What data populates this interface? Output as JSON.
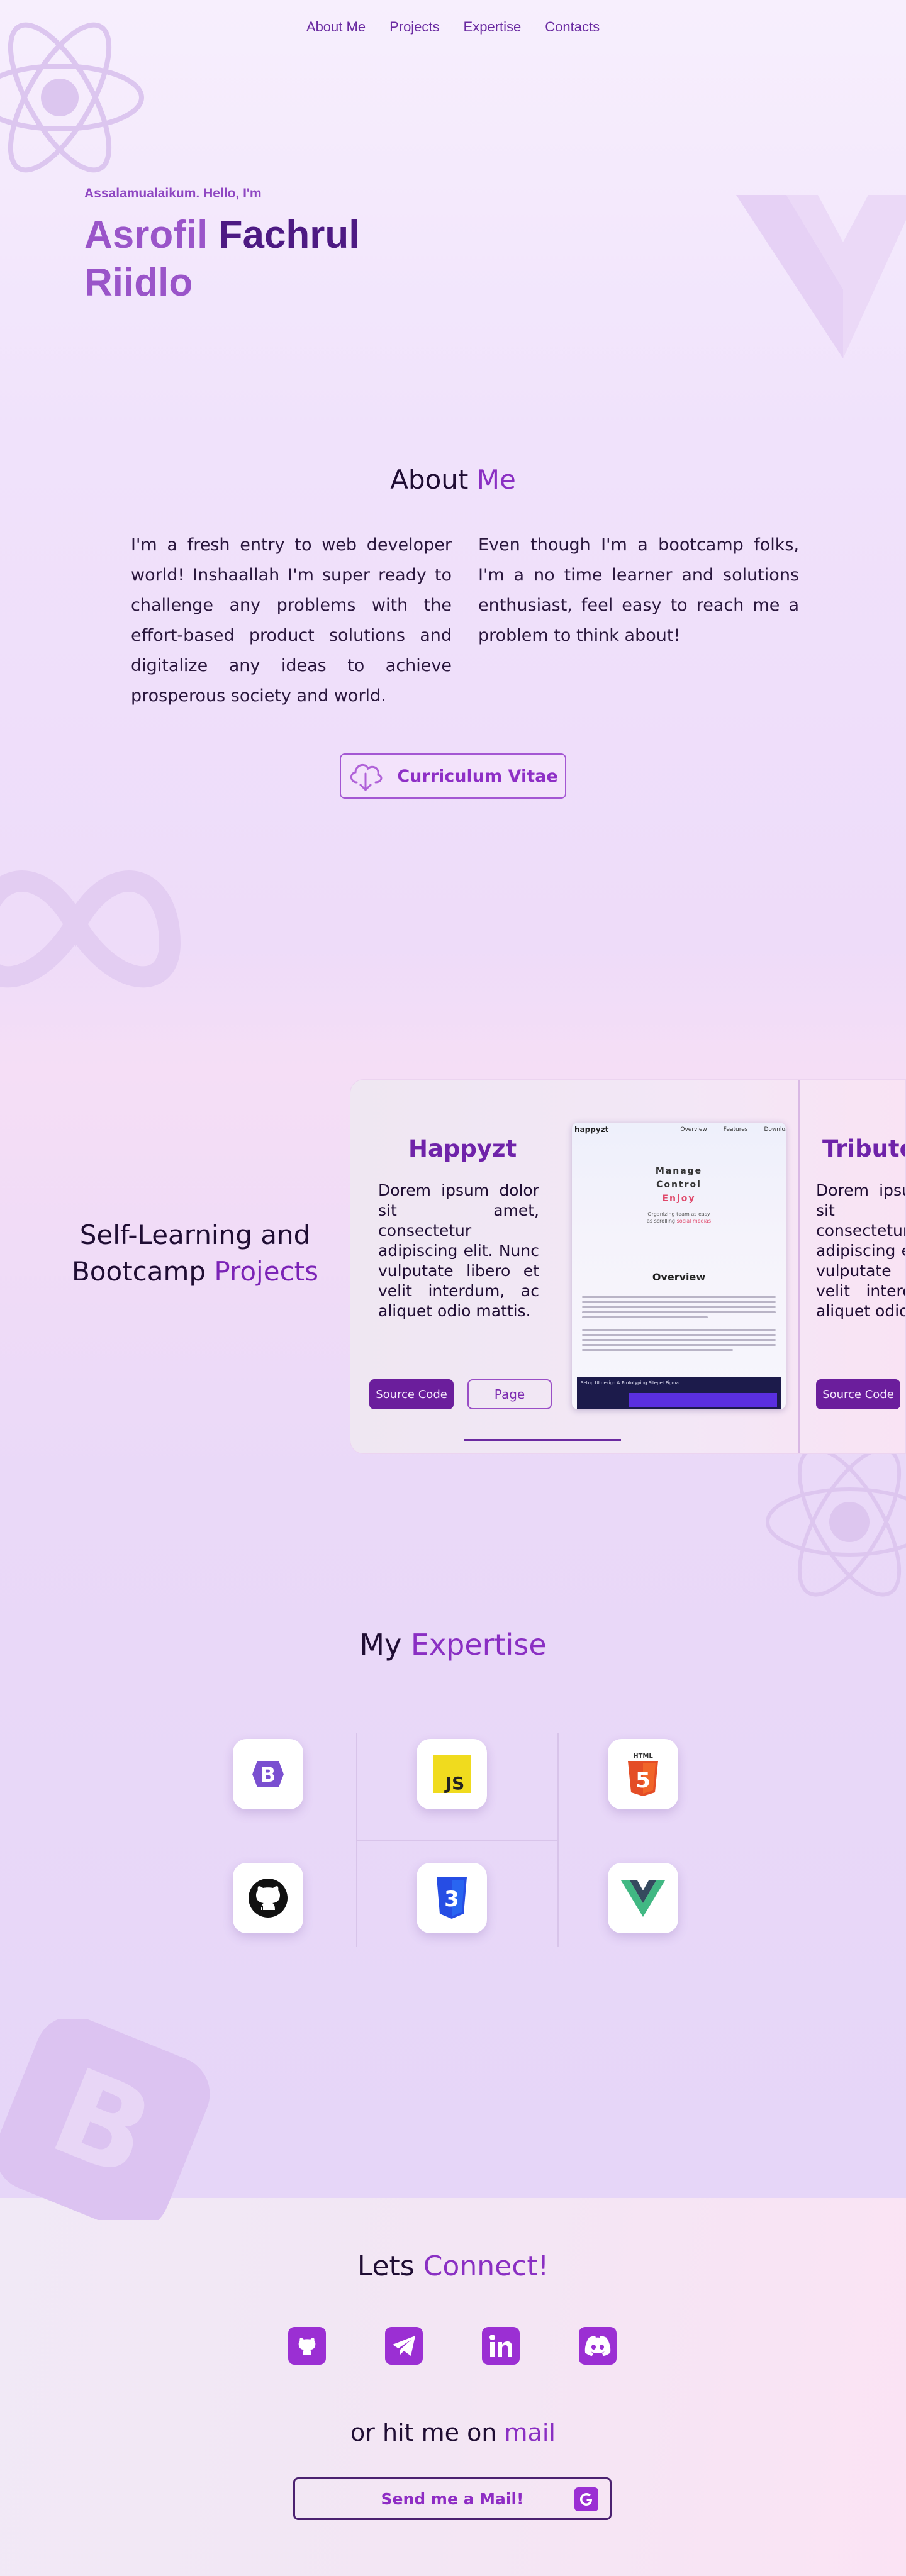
{
  "nav": {
    "items": [
      "About Me",
      "Projects",
      "Expertise",
      "Contacts"
    ]
  },
  "hero": {
    "greeting": "Assalamualaikum. Hello, I'm",
    "name_first": "Asrofil",
    "name_middle": "Fachrul",
    "name_last": "Riidlo"
  },
  "about": {
    "title_plain": "About",
    "title_accent": "Me",
    "paragraph_left": "I'm a fresh entry to web developer world! Inshaallah I'm super ready to challenge any problems with the effort-based product solutions and digitalize any ideas to achieve prosperous society and world.",
    "paragraph_right": "Even though I'm a bootcamp folks,  I'm a no time learner and solutions enthusiast, feel easy to reach me a problem to think about!",
    "cv_button": "Curriculum Vitae",
    "cv_icon": "cloud-download-icon"
  },
  "projects": {
    "heading_plain": "Self-Learning and Bootcamp",
    "heading_accent": "Projects",
    "cards": [
      {
        "title": "Happyzt",
        "description": "Dorem ipsum dolor sit amet, consectetur adipiscing elit. Nunc vulputate libero et velit interdum, ac aliquet odio mattis.",
        "source_button": "Source Code",
        "page_button": "Page",
        "preview": {
          "logo": "happyzt",
          "nav": [
            "Overview",
            "Features",
            "Download"
          ],
          "headline_1": "Manage",
          "headline_2": "Control",
          "headline_3": "Enjoy",
          "sub_1": "Organizing team as easy",
          "sub_2_plain": "as scrolling",
          "sub_2_red": "social medias",
          "section": "Overview",
          "video_title": "Setup UI design & Prototyping Sitepet Figma"
        }
      },
      {
        "title": "Tribute",
        "description": "Dorem ipsum dolor sit amet, consectetur adipiscing elit. Nunc vulputate libero et velit interdum, ac aliquet odio mattis.",
        "source_button": "Source Code"
      }
    ]
  },
  "expertise": {
    "title_plain": "My",
    "title_accent": "Expertise",
    "icons": [
      "bootstrap-icon",
      "javascript-icon",
      "html5-icon",
      "github-icon",
      "css3-icon",
      "vue-icon"
    ],
    "labels": {
      "js": "JS",
      "html": "HTML",
      "html_num": "5",
      "css_num": "3",
      "bootstrap": "B"
    }
  },
  "contact": {
    "title_plain": "Lets",
    "title_accent": "Connect!",
    "socials": [
      "github-icon",
      "telegram-icon",
      "linkedin-icon",
      "discord-icon"
    ],
    "mail_plain": "or hit me on",
    "mail_accent": "mail",
    "mail_button": "Send me a Mail!",
    "mail_icon": "gmail-icon"
  },
  "colors": {
    "accent": "#8a2fc3",
    "deep": "#4d1a83",
    "button": "#6b1e9c",
    "social": "#9b2fd3"
  }
}
